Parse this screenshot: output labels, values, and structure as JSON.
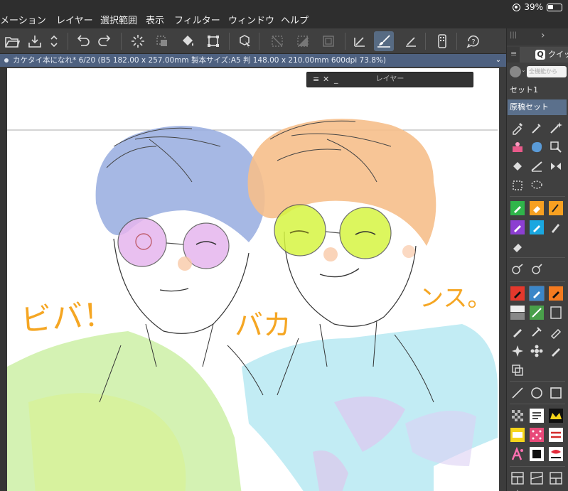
{
  "menu": [
    "メーション",
    "レイヤー",
    "選択範囲",
    "表示",
    "フィルター",
    "ウィンドウ",
    "ヘルプ"
  ],
  "status": {
    "battery": "39%"
  },
  "document_tab": {
    "title": "カケタイ本になれ* 6/20 (B5 182.00 x 257.00mm 製本サイズ:A5 判 148.00 x 210.00mm 600dpi 73.8%)"
  },
  "layer_window": {
    "title": "レイヤー",
    "menu_icon": "≡",
    "close": "✕",
    "minimize": "_"
  },
  "right_panel": {
    "header_menu": "|||",
    "header_chevron": "›",
    "tab_menu": "≡",
    "quick_tab_label": "クイッ",
    "quick_tab_icon": "Q",
    "search_placeholder": "全機能から",
    "set_label": "セット1",
    "selected_set": "原稿セット"
  },
  "artwork_text": {
    "line1": "ビバ！",
    "line2": "バカ",
    "line3": "ンス。"
  },
  "colors": {
    "menubar": "#2e2e2e",
    "toolbar": "#404040",
    "tab_accent": "#4e6180",
    "selected_set": "#5b708c",
    "active_tool": "#576b83"
  }
}
